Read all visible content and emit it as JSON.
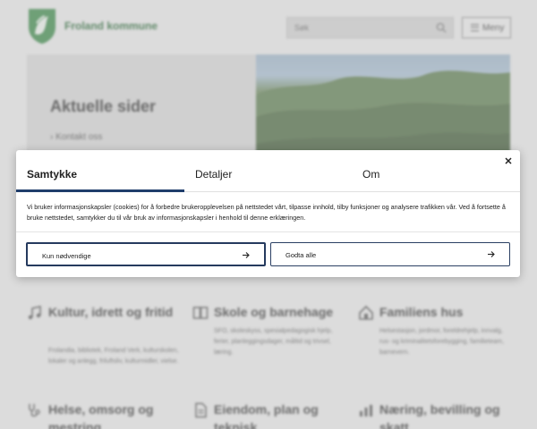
{
  "header": {
    "site_name": "Froland kommune",
    "search_placeholder": "Søk",
    "menu_label": "Meny"
  },
  "hero": {
    "title": "Aktuelle sider",
    "link": "Kontakt oss"
  },
  "categories": [
    {
      "title": "Kultur, idrett og fritid",
      "icon": "music-icon",
      "desc": "Frolandia, bibliotek, Froland Verk, kulturskolen, lokaler og anlegg, friluftsliv, kulturmidler, vielse."
    },
    {
      "title": "Skole og barnehage",
      "icon": "book-icon",
      "desc": "SFO, skoleskyss, spesialpedagogisk hjelp, ferier, planleggingsdager, måltid og trivsel, læring."
    },
    {
      "title": "Familiens hus",
      "icon": "house-icon",
      "desc": "Helsestasjon, jordmor, foreldrehjelp, innvalg, rus- og kriminalitetsforebygging, familieteam, barnevern."
    },
    {
      "title": "Helse, omsorg og mestring",
      "icon": "stethoscope-icon",
      "desc": ""
    },
    {
      "title": "Eiendom, plan og teknisk",
      "icon": "document-icon",
      "desc": ""
    },
    {
      "title": "Næring, bevilling og skatt",
      "icon": "chart-icon",
      "desc": ""
    }
  ],
  "dialog": {
    "tabs": [
      "Samtykke",
      "Detaljer",
      "Om"
    ],
    "active_tab": "Samtykke",
    "text": "Vi bruker informasjonskapsler (cookies) for å forbedre brukeropplevelsen på nettstedet vårt, tilpasse innhold, tilby funksjoner og analysere trafikken vår. Ved å fortsette å bruke nettstedet, samtykker du til vår bruk av informasjonskapsler i henhold til denne erklæringen.",
    "button_necessary": "Kun nødvendige",
    "button_accept": "Godta alle",
    "close_icon": "close-icon",
    "accent_color": "#1f3d6b"
  }
}
